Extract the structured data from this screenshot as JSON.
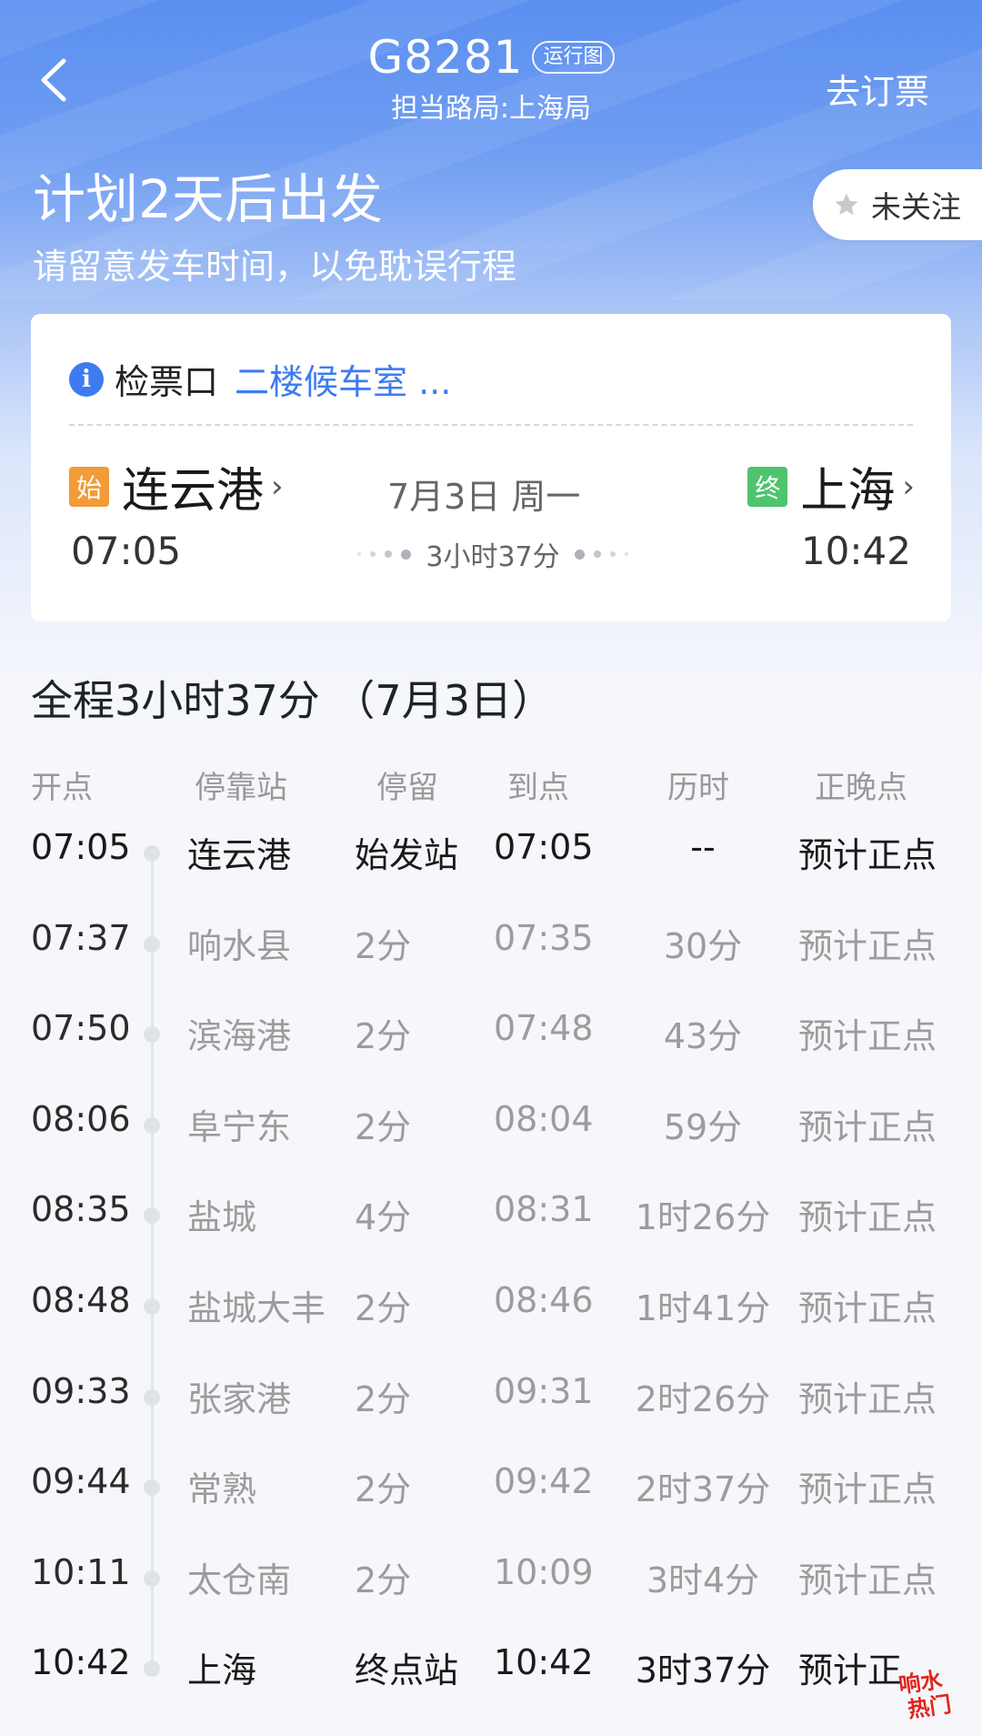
{
  "header": {
    "train_no": "G8281",
    "run_chart_badge": "运行图",
    "bureau": "担当路局:上海局",
    "book_link": "去订票"
  },
  "plan": {
    "title": "计划2天后出发",
    "subtitle": "请留意发车时间，以免耽误行程"
  },
  "follow": {
    "label": "未关注"
  },
  "card": {
    "gate_label": "检票口",
    "gate_value": "二楼候车室 ...",
    "from": {
      "tag": "始",
      "name": "连云港",
      "time": "07:05"
    },
    "to": {
      "tag": "终",
      "name": "上海",
      "time": "10:42"
    },
    "date": "7月3日 周一",
    "duration": "3小时37分"
  },
  "total": "全程3小时37分 （7月3日）",
  "columns": {
    "open": "开点",
    "station": "停靠站",
    "stay": "停留",
    "arrive": "到点",
    "elapsed": "历时",
    "punctuality": "正晚点"
  },
  "stops": [
    {
      "open": "07:05",
      "station": "连云港",
      "stay": "始发站",
      "arrive": "07:05",
      "elapsed": "--",
      "status": "预计正点",
      "highlight": true
    },
    {
      "open": "07:37",
      "station": "响水县",
      "stay": "2分",
      "arrive": "07:35",
      "elapsed": "30分",
      "status": "预计正点",
      "highlight": false
    },
    {
      "open": "07:50",
      "station": "滨海港",
      "stay": "2分",
      "arrive": "07:48",
      "elapsed": "43分",
      "status": "预计正点",
      "highlight": false
    },
    {
      "open": "08:06",
      "station": "阜宁东",
      "stay": "2分",
      "arrive": "08:04",
      "elapsed": "59分",
      "status": "预计正点",
      "highlight": false
    },
    {
      "open": "08:35",
      "station": "盐城",
      "stay": "4分",
      "arrive": "08:31",
      "elapsed": "1时26分",
      "status": "预计正点",
      "highlight": false
    },
    {
      "open": "08:48",
      "station": "盐城大丰",
      "stay": "2分",
      "arrive": "08:46",
      "elapsed": "1时41分",
      "status": "预计正点",
      "highlight": false
    },
    {
      "open": "09:33",
      "station": "张家港",
      "stay": "2分",
      "arrive": "09:31",
      "elapsed": "2时26分",
      "status": "预计正点",
      "highlight": false
    },
    {
      "open": "09:44",
      "station": "常熟",
      "stay": "2分",
      "arrive": "09:42",
      "elapsed": "2时37分",
      "status": "预计正点",
      "highlight": false
    },
    {
      "open": "10:11",
      "station": "太仓南",
      "stay": "2分",
      "arrive": "10:09",
      "elapsed": "3时4分",
      "status": "预计正点",
      "highlight": false
    },
    {
      "open": "10:42",
      "station": "上海",
      "stay": "终点站",
      "arrive": "10:42",
      "elapsed": "3时37分",
      "status": "预计正",
      "highlight": true
    }
  ],
  "watermark": "响水热门",
  "colors": {
    "accent": "#3d7cf0",
    "start_tag": "#f29b38",
    "end_tag": "#4fc46f",
    "muted_text": "#9c9c9c"
  },
  "icons": {
    "back": "back-arrow-icon",
    "follow": "star-icon",
    "info": "info-icon"
  }
}
